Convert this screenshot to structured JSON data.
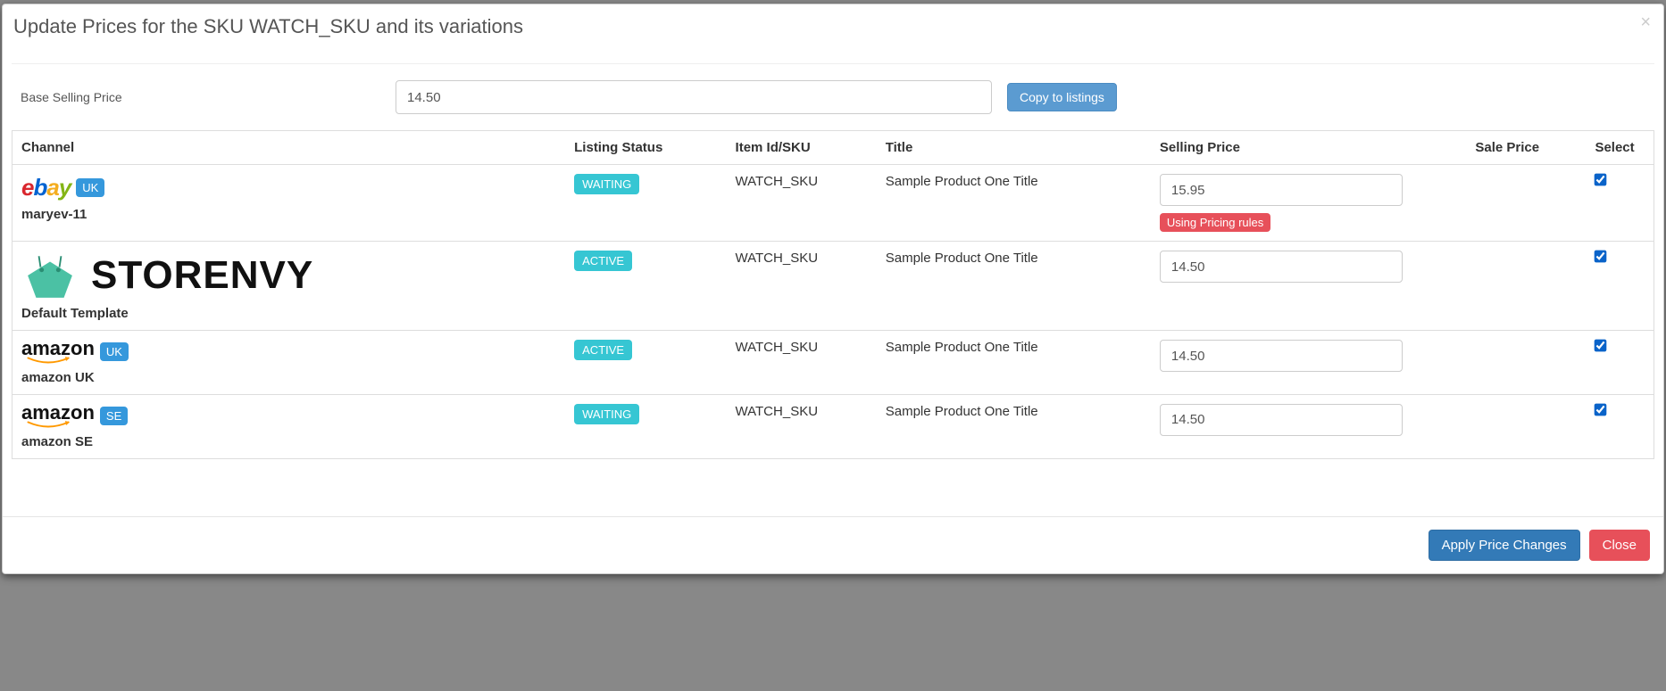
{
  "modal": {
    "title": "Update Prices for the SKU WATCH_SKU and its variations",
    "basePriceLabel": "Base Selling Price",
    "basePriceValue": "14.50",
    "copyButtonLabel": "Copy to listings"
  },
  "tableHeaders": {
    "channel": "Channel",
    "listingStatus": "Listing Status",
    "itemIdSku": "Item Id/SKU",
    "title": "Title",
    "sellingPrice": "Selling Price",
    "salePrice": "Sale Price",
    "select": "Select"
  },
  "rows": [
    {
      "channelType": "ebay",
      "region": "UK",
      "channelName": "maryev-11",
      "status": "WAITING",
      "statusClass": "status-waiting",
      "sku": "WATCH_SKU",
      "title": "Sample Product One Title",
      "sellingPrice": "15.95",
      "pricingRules": "Using Pricing rules",
      "checked": true
    },
    {
      "channelType": "storenvy",
      "region": "",
      "channelName": "Default Template",
      "status": "ACTIVE",
      "statusClass": "status-active",
      "sku": "WATCH_SKU",
      "title": "Sample Product One Title",
      "sellingPrice": "14.50",
      "pricingRules": "",
      "checked": true
    },
    {
      "channelType": "amazon",
      "region": "UK",
      "channelName": "amazon UK",
      "status": "ACTIVE",
      "statusClass": "status-active",
      "sku": "WATCH_SKU",
      "title": "Sample Product One Title",
      "sellingPrice": "14.50",
      "pricingRules": "",
      "checked": true
    },
    {
      "channelType": "amazon",
      "region": "SE",
      "channelName": "amazon SE",
      "status": "WAITING",
      "statusClass": "status-waiting",
      "sku": "WATCH_SKU",
      "title": "Sample Product One Title",
      "sellingPrice": "14.50",
      "pricingRules": "",
      "checked": true
    }
  ],
  "footer": {
    "applyLabel": "Apply Price Changes",
    "closeLabel": "Close"
  }
}
